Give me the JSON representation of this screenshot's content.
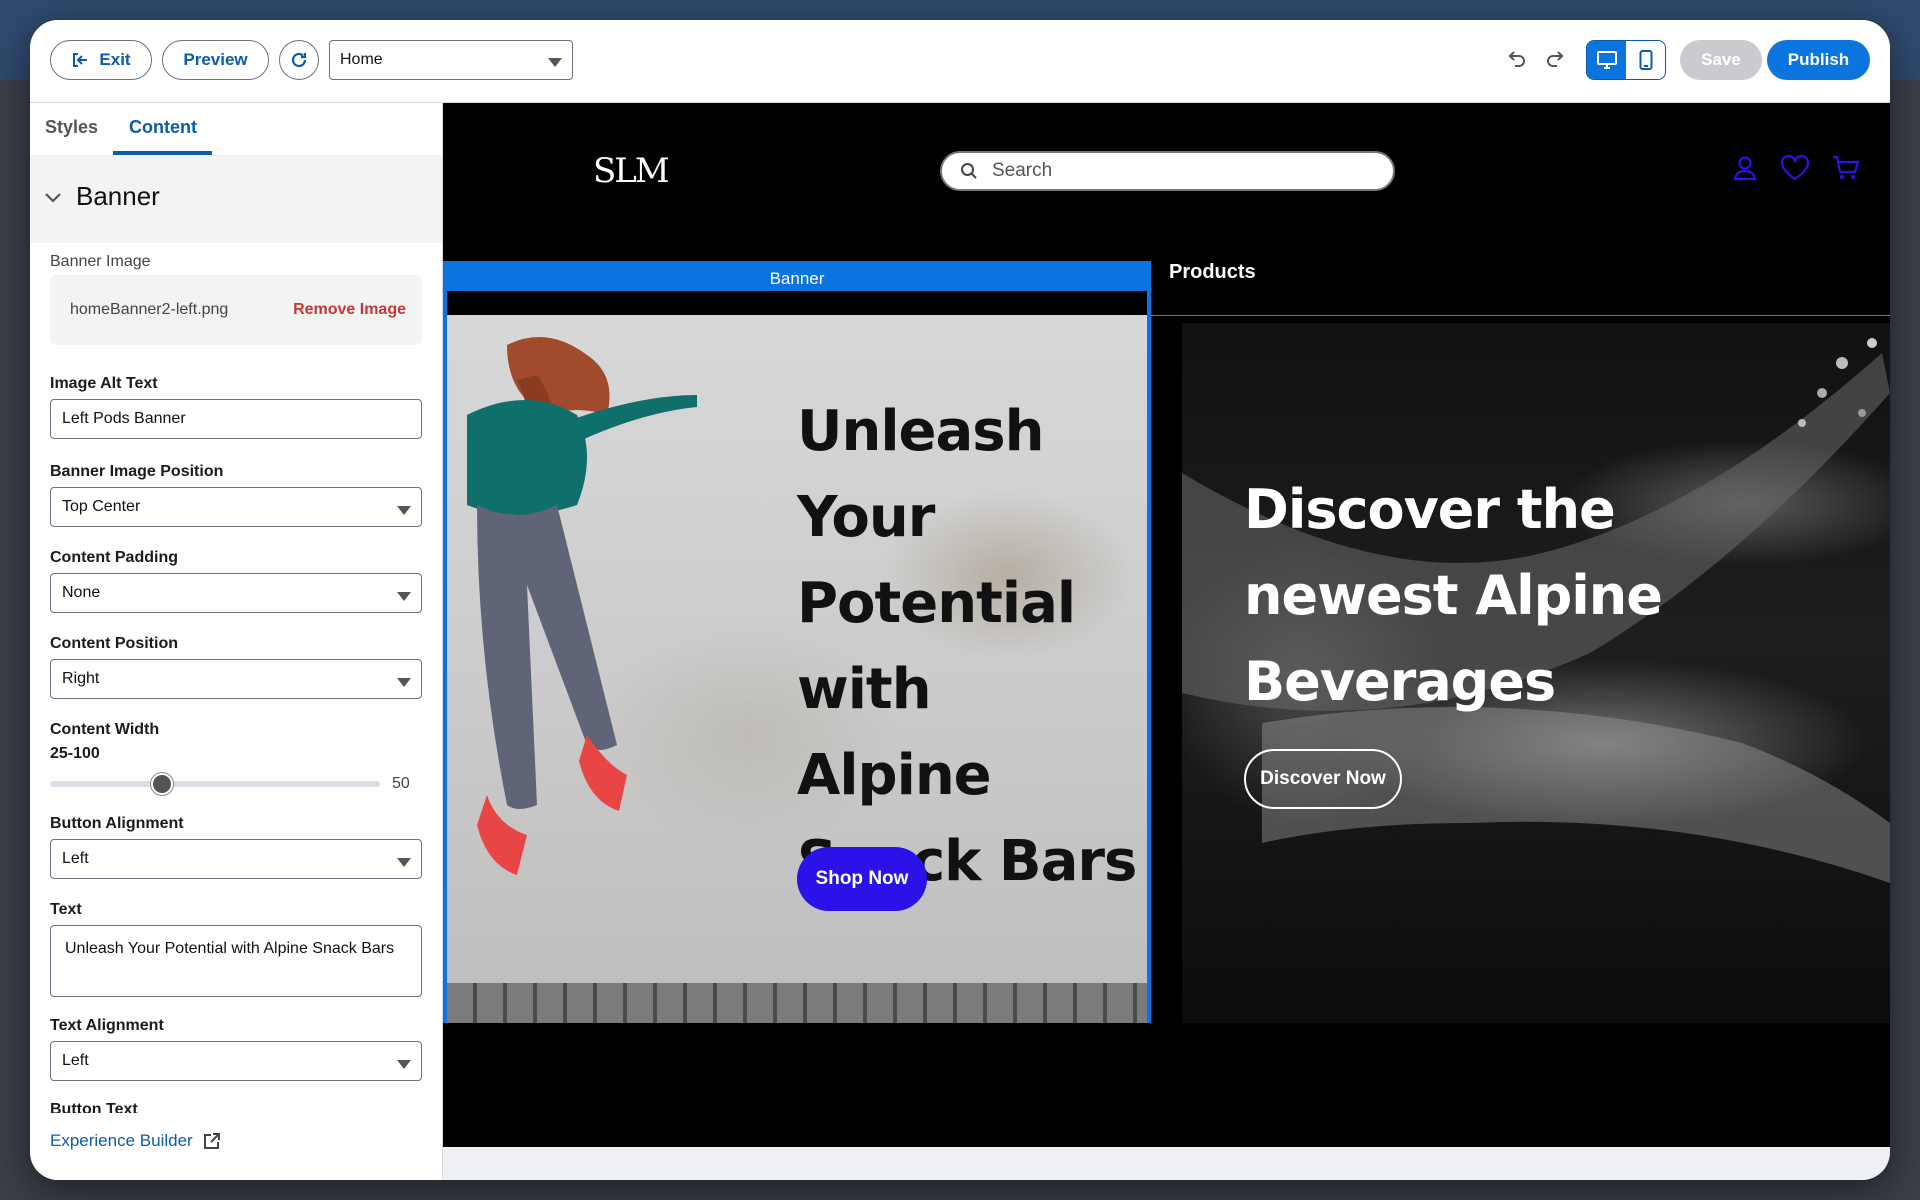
{
  "toolbar": {
    "exit_label": "Exit",
    "preview_label": "Preview",
    "page_select_value": "Home",
    "save_label": "Save",
    "publish_label": "Publish"
  },
  "sidebar": {
    "tabs": [
      {
        "label": "Styles",
        "active": false
      },
      {
        "label": "Content",
        "active": true
      }
    ],
    "section_title": "Banner",
    "fields": {
      "banner_image_label": "Banner Image",
      "banner_image_file": "homeBanner2-left.png",
      "remove_image_label": "Remove Image",
      "alt_text_label": "Image Alt Text",
      "alt_text_value": "Left Pods Banner",
      "image_position_label": "Banner Image Position",
      "image_position_value": "Top Center",
      "content_padding_label": "Content Padding",
      "content_padding_value": "None",
      "content_position_label": "Content Position",
      "content_position_value": "Right",
      "content_width_label": "Content Width",
      "content_width_range": "25-100",
      "content_width_value": "50",
      "button_alignment_label": "Button Alignment",
      "button_alignment_value": "Left",
      "text_label": "Text",
      "text_value": "Unleash Your Potential with Alpine Snack Bars",
      "text_alignment_label": "Text Alignment",
      "text_alignment_value": "Left",
      "button_text_label": "Button Text"
    },
    "footer_link": "Experience Builder"
  },
  "site": {
    "logo": "SLM",
    "search_placeholder": "Search",
    "nav_item": "Products",
    "banner_tag": "Banner",
    "left_banner": {
      "heading": "Unleash Your Potential with Alpine Snack Bars",
      "button": "Shop Now"
    },
    "right_banner": {
      "heading": "Discover the newest Alpine Beverages",
      "button": "Discover Now"
    }
  },
  "colors": {
    "accent": "#0b74de",
    "link": "#0b5cab",
    "danger": "#c23934",
    "shop_button": "#2a12e8",
    "site_icon": "#2a12e8"
  }
}
